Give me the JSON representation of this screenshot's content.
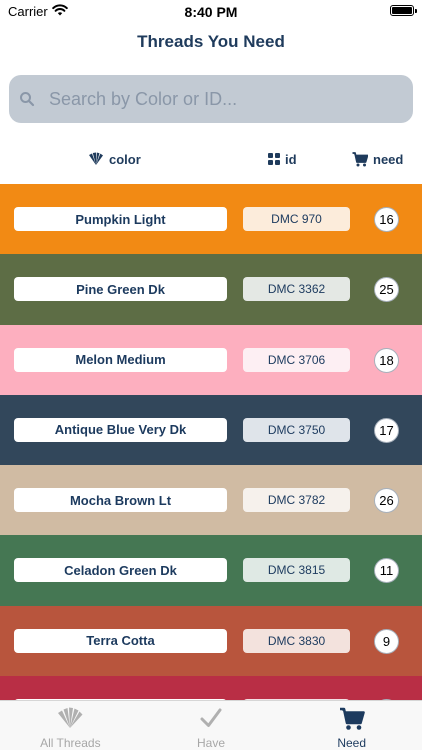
{
  "status_bar": {
    "carrier": "Carrier",
    "time": "8:40 PM"
  },
  "nav": {
    "title": "Threads You Need"
  },
  "search": {
    "placeholder": "Search by Color or ID..."
  },
  "columns": {
    "color": "color",
    "id": "id",
    "need": "need"
  },
  "threads": [
    {
      "name": "Pumpkin Light",
      "id": "DMC 970",
      "need": "16",
      "bg": "#f28a14",
      "pill": "#fcecdb"
    },
    {
      "name": "Pine Green Dk",
      "id": "DMC 3362",
      "need": "25",
      "bg": "#5d6d45",
      "pill": "#e4e8e4"
    },
    {
      "name": "Melon Medium",
      "id": "DMC 3706",
      "need": "18",
      "bg": "#fdafbf",
      "pill": "#fdeff3"
    },
    {
      "name": "Antique Blue Very Dk",
      "id": "DMC 3750",
      "need": "17",
      "bg": "#32475b",
      "pill": "#dfe4ea"
    },
    {
      "name": "Mocha Brown Lt",
      "id": "DMC 3782",
      "need": "26",
      "bg": "#d0bba3",
      "pill": "#f6f1ec"
    },
    {
      "name": "Celadon Green Dk",
      "id": "DMC 3815",
      "need": "11",
      "bg": "#457753",
      "pill": "#dfe9e4"
    },
    {
      "name": "Terra Cotta",
      "id": "DMC 3830",
      "need": "9",
      "bg": "#b8553d",
      "pill": "#f3e2dd"
    },
    {
      "name": "",
      "id": "",
      "need": "",
      "bg": "#b92e45",
      "pill": "#f3e0e4"
    }
  ],
  "tabs": [
    {
      "label": "All Threads",
      "icon": "threads-icon",
      "active": false
    },
    {
      "label": "Have",
      "icon": "checkmark-icon",
      "active": false
    },
    {
      "label": "Need",
      "icon": "cart-icon",
      "active": true
    }
  ]
}
